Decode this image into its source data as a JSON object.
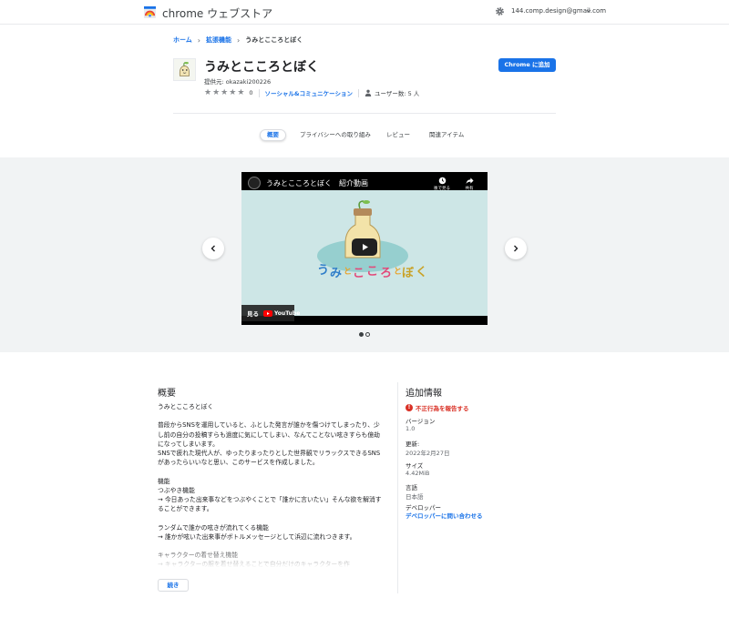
{
  "header": {
    "store_title": "chrome ウェブストア",
    "account_email": "144.comp.design@gmail.com"
  },
  "breadcrumb": {
    "home": "ホーム",
    "extensions": "拡張機能",
    "current": "うみとこころとぼく"
  },
  "item": {
    "title": "うみとこころとぼく",
    "provider": "提供元: okazaki200226",
    "rating_count": "0",
    "category": "ソーシャル&コミュニケーション",
    "users": "ユーザー数: 5 人",
    "add_button": "Chrome に追加"
  },
  "tabs": [
    {
      "label": "概要",
      "active": true
    },
    {
      "label": "プライバシーへの取り組み",
      "active": false
    },
    {
      "label": "レビュー",
      "active": false
    },
    {
      "label": "関連アイテム",
      "active": false
    }
  ],
  "video": {
    "title": "うみとこころとぼく　紹介動画",
    "watch_later": "後で見る",
    "share": "共有",
    "watch_on": "見る",
    "youtube": "YouTube"
  },
  "overview": {
    "title": "概要",
    "body": "うみとこころとぼく\n\n普段からSNSを運用していると、ふとした発言が誰かを傷つけてしまったり、少し前の自分の投稿すらも過度に気にしてしまい、なんてことない呟きすらも億劫になってしまいます。\nSNSで疲れた現代人が、ゆったりまったりとした世界観でリラックスできるSNSがあったらいいなと思い、このサービスを作成しました。\n\n機能\nつぶやき機能\n→ 今日あった出来事などをつぶやくことで「誰かに言いたい」そんな欲を解消することができます。\n\nランダムで誰かの呟きが流れてくる機能\n→ 誰かが呟いた出来事がボトルメッセージとして浜辺に流れつきます。\n\n キャラクターの着せ替え機能\n→ キャラクターの服を着せ替えることで自分だけのキャラクターを作",
    "more_button": "続き"
  },
  "additional_info": {
    "title": "追加情報",
    "report": "不正行為を報告する",
    "version_label": "バージョン",
    "version": "1.0",
    "updated_label": "更新:",
    "updated": "2022年2月27日",
    "size_label": "サイズ",
    "size": "4.42MiB",
    "language_label": "言語",
    "language": "日本語",
    "developer_label": "デベロッパー",
    "contact_developer": "デベロッパーに問い合わせる"
  }
}
